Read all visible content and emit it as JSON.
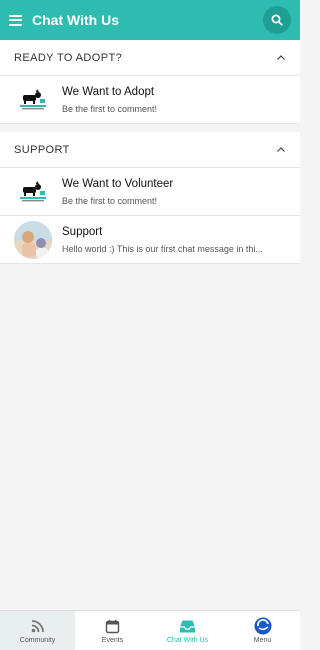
{
  "app_bar": {
    "title": "Chat With Us",
    "menu_icon": "hamburger-icon",
    "search_icon": "search-icon"
  },
  "sections": [
    {
      "title": "READY TO ADOPT?",
      "chats": [
        {
          "title": "We Want to Adopt",
          "subtitle": "Be the first to comment!",
          "avatar": "rescue-logo-avatar"
        }
      ]
    },
    {
      "title": "SUPPORT",
      "chats": [
        {
          "title": "We Want to Volunteer",
          "subtitle": "Be the first to comment!",
          "avatar": "rescue-logo-avatar"
        },
        {
          "title": "Support",
          "subtitle": "Hello world :) This is our first chat message in thi...",
          "avatar": "photo-avatar"
        }
      ]
    }
  ],
  "tab_bar": {
    "tabs": [
      {
        "label": "Community",
        "icon": "signal-icon"
      },
      {
        "label": "Events",
        "icon": "calendar-icon"
      },
      {
        "label": "Chat With Us",
        "icon": "inbox-icon",
        "active": true
      },
      {
        "label": "Menu",
        "icon": "app-logo-icon"
      }
    ]
  },
  "colors": {
    "accent": "#2ebcb0",
    "accent_dark": "#1f9e94",
    "menu_logo": "#1a57c9"
  }
}
